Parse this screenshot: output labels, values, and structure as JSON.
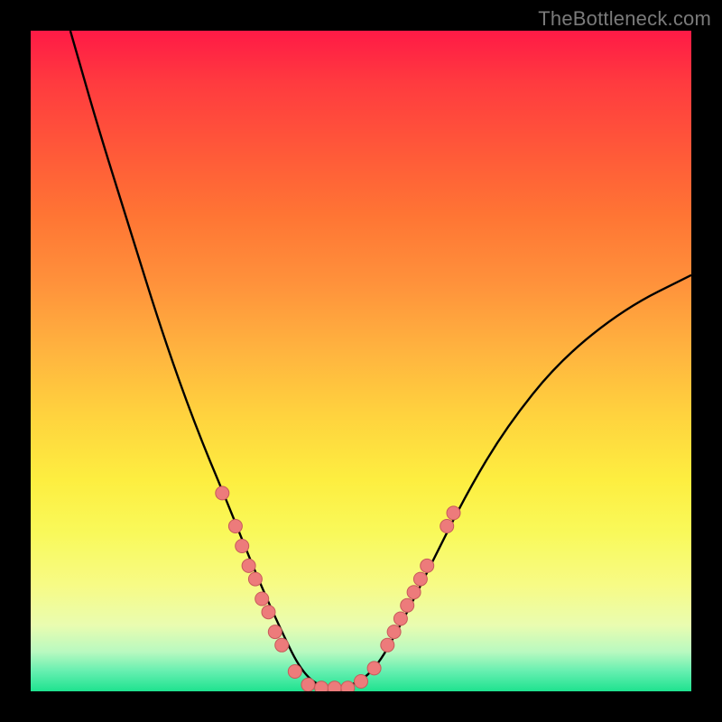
{
  "watermark": "TheBottleneck.com",
  "chart_data": {
    "type": "line",
    "title": "",
    "xlabel": "",
    "ylabel": "",
    "xlim": [
      0,
      100
    ],
    "ylim": [
      0,
      100
    ],
    "series": [
      {
        "name": "curve",
        "values": [
          {
            "x": 6,
            "y": 100
          },
          {
            "x": 10,
            "y": 86
          },
          {
            "x": 15,
            "y": 70
          },
          {
            "x": 20,
            "y": 54
          },
          {
            "x": 25,
            "y": 40
          },
          {
            "x": 30,
            "y": 28
          },
          {
            "x": 34,
            "y": 18
          },
          {
            "x": 38,
            "y": 9
          },
          {
            "x": 41,
            "y": 3
          },
          {
            "x": 44,
            "y": 0.5
          },
          {
            "x": 48,
            "y": 0.5
          },
          {
            "x": 52,
            "y": 3
          },
          {
            "x": 56,
            "y": 10
          },
          {
            "x": 60,
            "y": 18
          },
          {
            "x": 66,
            "y": 30
          },
          {
            "x": 72,
            "y": 40
          },
          {
            "x": 80,
            "y": 50
          },
          {
            "x": 90,
            "y": 58
          },
          {
            "x": 100,
            "y": 63
          }
        ]
      }
    ],
    "markers": [
      {
        "x": 29,
        "y": 30
      },
      {
        "x": 31,
        "y": 25
      },
      {
        "x": 32,
        "y": 22
      },
      {
        "x": 33,
        "y": 19
      },
      {
        "x": 34,
        "y": 17
      },
      {
        "x": 35,
        "y": 14
      },
      {
        "x": 36,
        "y": 12
      },
      {
        "x": 37,
        "y": 9
      },
      {
        "x": 38,
        "y": 7
      },
      {
        "x": 40,
        "y": 3
      },
      {
        "x": 42,
        "y": 1
      },
      {
        "x": 44,
        "y": 0.5
      },
      {
        "x": 46,
        "y": 0.5
      },
      {
        "x": 48,
        "y": 0.5
      },
      {
        "x": 50,
        "y": 1.5
      },
      {
        "x": 52,
        "y": 3.5
      },
      {
        "x": 54,
        "y": 7
      },
      {
        "x": 55,
        "y": 9
      },
      {
        "x": 56,
        "y": 11
      },
      {
        "x": 57,
        "y": 13
      },
      {
        "x": 58,
        "y": 15
      },
      {
        "x": 59,
        "y": 17
      },
      {
        "x": 60,
        "y": 19
      },
      {
        "x": 63,
        "y": 25
      },
      {
        "x": 64,
        "y": 27
      }
    ],
    "colors": {
      "curve": "#000000",
      "marker_fill": "#ed7b7b",
      "marker_stroke": "#c75a5a"
    }
  }
}
